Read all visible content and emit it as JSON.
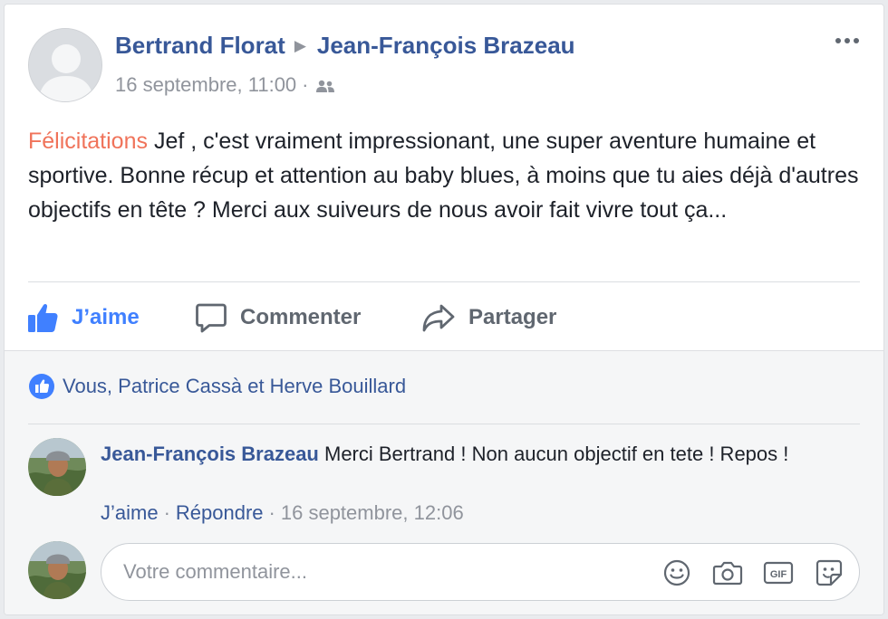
{
  "post": {
    "author": "Bertrand Florat",
    "target": "Jean-François Brazeau",
    "timestamp": "16 septembre, 11:00",
    "audience_icon": "friends-icon",
    "highlight": "Félicitations",
    "text": " Jef , c'est vraiment impressionant, une super aventure humaine et sportive. Bonne récup et attention au baby blues, à moins que tu aies déjà d'autres objectifs en tête ? Merci aux suiveurs de nous avoir fait vivre tout ça..."
  },
  "actions": {
    "like": "J’aime",
    "comment": "Commenter",
    "share": "Partager"
  },
  "likes": {
    "text": "Vous, Patrice Cassà et Herve Bouillard"
  },
  "comment": {
    "author": "Jean-François Brazeau",
    "text": " Merci Bertrand ! Non aucun objectif en tete ! Repos !",
    "like": "J’aime",
    "reply": "Répondre",
    "timestamp": "16 septembre, 12:06"
  },
  "reply_box": {
    "placeholder": "Votre commentaire..."
  },
  "colors": {
    "link": "#385898",
    "like_active": "#4080ff",
    "highlight": "#f0735a",
    "muted": "#90949c"
  }
}
